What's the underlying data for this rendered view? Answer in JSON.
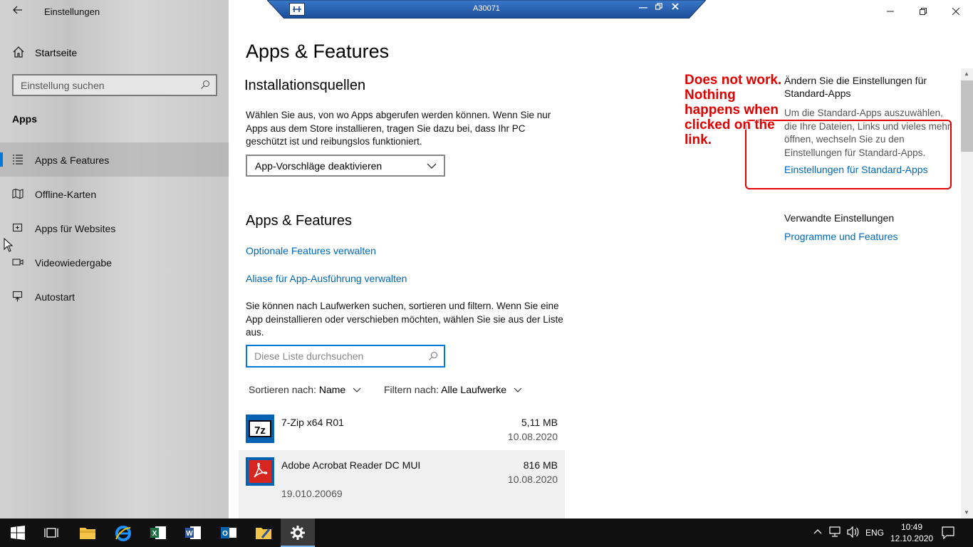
{
  "window": {
    "app_title": "Einstellungen",
    "remote_title": "A30071"
  },
  "sidebar": {
    "home_label": "Startseite",
    "search_placeholder": "Einstellung suchen",
    "section": "Apps",
    "items": [
      {
        "label": "Apps & Features",
        "icon": "list-icon",
        "active": true
      },
      {
        "label": "Offline-Karten",
        "icon": "map-icon"
      },
      {
        "label": "Apps für Websites",
        "icon": "web-app-icon"
      },
      {
        "label": "Videowiedergabe",
        "icon": "video-icon"
      },
      {
        "label": "Autostart",
        "icon": "startup-icon"
      }
    ]
  },
  "main": {
    "title": "Apps & Features",
    "install_sources": {
      "heading": "Installationsquellen",
      "description": "Wählen Sie aus, von wo Apps abgerufen werden können. Wenn Sie nur Apps aus dem Store installieren, tragen Sie dazu bei, dass Ihr PC geschützt ist und reibungslos funktioniert.",
      "dropdown_value": "App-Vorschläge deaktivieren"
    },
    "apps_features": {
      "heading": "Apps & Features",
      "link_optional": "Optionale Features verwalten",
      "link_alias": "Aliase für App-Ausführung verwalten",
      "description": "Sie können nach Laufwerken suchen, sortieren und filtern. Wenn Sie eine App deinstallieren oder verschieben möchten, wählen Sie sie aus der Liste aus.",
      "search_placeholder": "Diese Liste durchsuchen",
      "sort_label": "Sortieren nach:",
      "sort_value": "Name",
      "filter_label": "Filtern nach:",
      "filter_value": "Alle Laufwerke"
    },
    "apps": [
      {
        "name": "7-Zip x64 R01",
        "size": "5,11 MB",
        "date": "10.08.2020",
        "version": ""
      },
      {
        "name": "Adobe Acrobat Reader DC MUI",
        "size": "816 MB",
        "date": "10.08.2020",
        "version": "19.010.20069"
      }
    ]
  },
  "right": {
    "default_apps_title": "Ändern Sie die Einstellungen für Standard-Apps",
    "default_apps_body": "Um die Standard-Apps auszuwählen, die Ihre Dateien, Links und vieles mehr öffnen, wechseln Sie zu den Einstellungen für Standard-Apps.",
    "default_apps_link": "Einstellungen für Standard-Apps",
    "related_title": "Verwandte Einstellungen",
    "related_link": "Programme und Features",
    "annotation": "Does not work. Nothing happens when clicked on the link."
  },
  "taskbar": {
    "language": "ENG",
    "time": "10:49",
    "date": "12.10.2020"
  },
  "colors": {
    "accent": "#0078d7",
    "link": "#0067b8",
    "annotation": "#e00000"
  }
}
